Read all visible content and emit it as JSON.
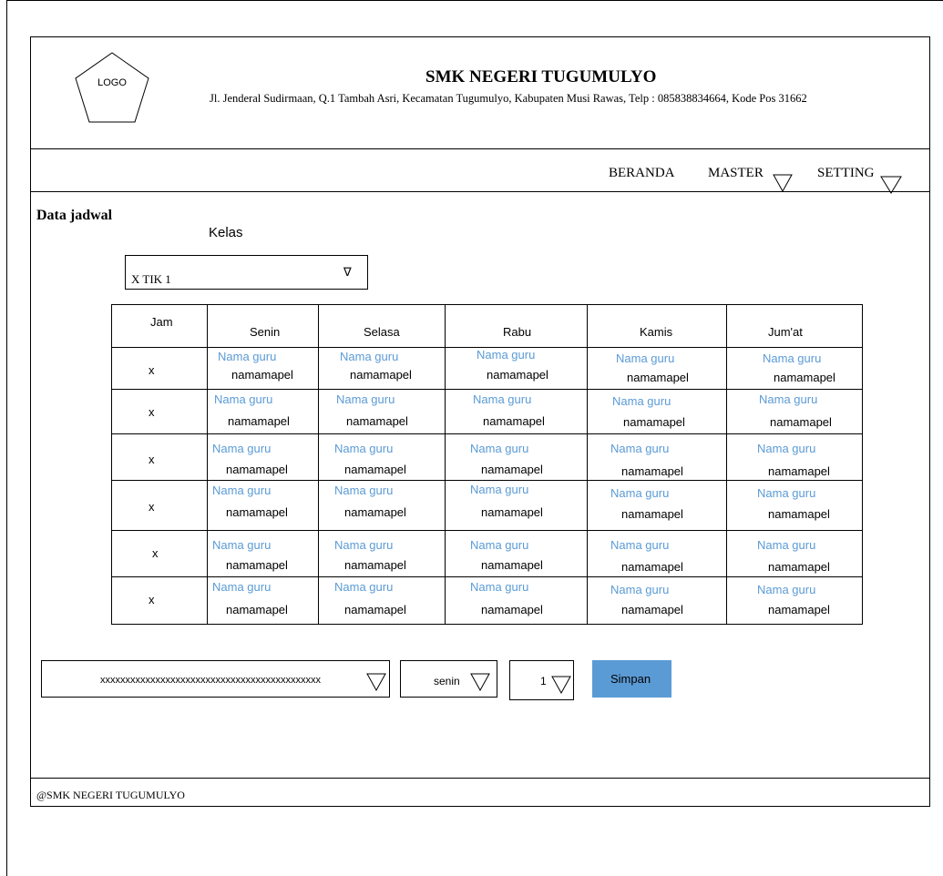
{
  "header": {
    "logo_label": "LOGO",
    "school_name": "SMK NEGERI TUGUMULYO",
    "address": "Jl. Jenderal Sudirmaan, Q.1 Tambah Asri, Kecamatan Tugumulyo, Kabupaten Musi Rawas, Telp : 085838834664, Kode Pos 31662"
  },
  "nav": {
    "items": [
      {
        "label": "BERANDA"
      },
      {
        "label": "MASTER"
      },
      {
        "label": "SETTING"
      }
    ]
  },
  "main": {
    "title": "Data jadwal",
    "kelas_label": "Kelas",
    "kelas_value": "X TIK 1",
    "kelas_arrow": "∇"
  },
  "schedule": {
    "headers": [
      "Jam",
      "Senin",
      "Selasa",
      "Rabu",
      "Kamis",
      "Jum'at"
    ],
    "rows": [
      {
        "jam": "x",
        "cells": [
          {
            "guru": "Nama guru",
            "mapel": "namamapel"
          },
          {
            "guru": "Nama guru",
            "mapel": "namamapel"
          },
          {
            "guru": "Nama guru",
            "mapel": "namamapel"
          },
          {
            "guru": "Nama guru",
            "mapel": "namamapel"
          },
          {
            "guru": "Nama guru",
            "mapel": "namamapel"
          }
        ]
      },
      {
        "jam": "x",
        "cells": [
          {
            "guru": "Nama guru",
            "mapel": "namamapel"
          },
          {
            "guru": "Nama guru",
            "mapel": "namamapel"
          },
          {
            "guru": "Nama guru",
            "mapel": "namamapel"
          },
          {
            "guru": "Nama guru",
            "mapel": "namamapel"
          },
          {
            "guru": "Nama guru",
            "mapel": "namamapel"
          }
        ]
      },
      {
        "jam": "x",
        "cells": [
          {
            "guru": "Nama guru",
            "mapel": "namamapel"
          },
          {
            "guru": "Nama guru",
            "mapel": "namamapel"
          },
          {
            "guru": "Nama guru",
            "mapel": "namamapel"
          },
          {
            "guru": "Nama guru",
            "mapel": "namamapel"
          },
          {
            "guru": "Nama guru",
            "mapel": "namamapel"
          }
        ]
      },
      {
        "jam": "x",
        "cells": [
          {
            "guru": "Nama guru",
            "mapel": "namamapel"
          },
          {
            "guru": "Nama guru",
            "mapel": "namamapel"
          },
          {
            "guru": "Nama guru",
            "mapel": "namamapel"
          },
          {
            "guru": "Nama guru",
            "mapel": "namamapel"
          },
          {
            "guru": "Nama guru",
            "mapel": "namamapel"
          }
        ]
      },
      {
        "jam": "x",
        "cells": [
          {
            "guru": "Nama guru",
            "mapel": "namamapel"
          },
          {
            "guru": "Nama guru",
            "mapel": "namamapel"
          },
          {
            "guru": "Nama guru",
            "mapel": "namamapel"
          },
          {
            "guru": "Nama guru",
            "mapel": "namamapel"
          },
          {
            "guru": "Nama guru",
            "mapel": "namamapel"
          }
        ]
      },
      {
        "jam": "x",
        "cells": [
          {
            "guru": "Nama guru",
            "mapel": "namamapel"
          },
          {
            "guru": "Nama guru",
            "mapel": "namamapel"
          },
          {
            "guru": "Nama guru",
            "mapel": "namamapel"
          },
          {
            "guru": "Nama guru",
            "mapel": "namamapel"
          },
          {
            "guru": "Nama guru",
            "mapel": "namamapel"
          }
        ]
      }
    ]
  },
  "form": {
    "guru_mapel_value": "xxxxxxxxxxxxxxxxxxxxxxxxxxxxxxxxxxxxxxxxxxxx",
    "day_value": "senin",
    "jam_value": "1",
    "save_label": "Simpan"
  },
  "footer": {
    "text": "@SMK NEGERI TUGUMULYO"
  },
  "colors": {
    "accent": "#5b9bd5",
    "guru_text": "#5b9bd5"
  }
}
